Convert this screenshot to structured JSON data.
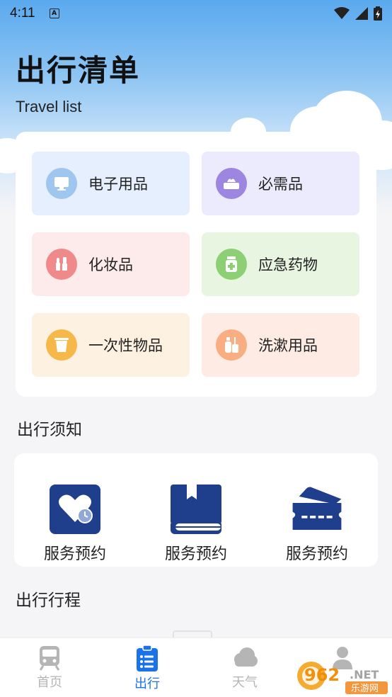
{
  "status_bar": {
    "time": "4:11",
    "notification_glyph": "A"
  },
  "header": {
    "title": "出行清单",
    "subtitle": "Travel list"
  },
  "categories": [
    {
      "label": "电子用品",
      "icon": "monitor-icon",
      "bg": "#e6effd",
      "icon_bg": "#9ec6ef"
    },
    {
      "label": "必需品",
      "icon": "tissue-box-icon",
      "bg": "#ecebfd",
      "icon_bg": "#9d86e0"
    },
    {
      "label": "化妆品",
      "icon": "cosmetics-icon",
      "bg": "#fdeaea",
      "icon_bg": "#f08a8a"
    },
    {
      "label": "应急药物",
      "icon": "medicine-bottle-icon",
      "bg": "#e7f5e1",
      "icon_bg": "#8ccf74"
    },
    {
      "label": "一次性物品",
      "icon": "disposable-cup-icon",
      "bg": "#fdf1e1",
      "icon_bg": "#f7b84a"
    },
    {
      "label": "洗漱用品",
      "icon": "toiletries-icon",
      "bg": "#feebe4",
      "icon_bg": "#f8ad82"
    }
  ],
  "notice": {
    "title": "出行须知",
    "services": [
      {
        "label": "服务预约",
        "icon": "heart-clock-icon"
      },
      {
        "label": "服务预约",
        "icon": "book-icon"
      },
      {
        "label": "服务预约",
        "icon": "ticket-icon"
      }
    ]
  },
  "itinerary": {
    "title": "出行行程"
  },
  "tabbar": {
    "items": [
      {
        "label": "首页",
        "icon": "train-icon",
        "active": false
      },
      {
        "label": "出行",
        "icon": "clipboard-list-icon",
        "active": true
      },
      {
        "label": "天气",
        "icon": "cloud-icon",
        "active": false
      },
      {
        "label": "",
        "icon": "user-icon",
        "active": false
      }
    ]
  },
  "watermark": {
    "brand": "962.NET",
    "caption": "乐游网"
  },
  "colors": {
    "accent": "#1a73e8",
    "navy": "#1f3f8c",
    "tab_inactive": "#b5b5b5"
  }
}
